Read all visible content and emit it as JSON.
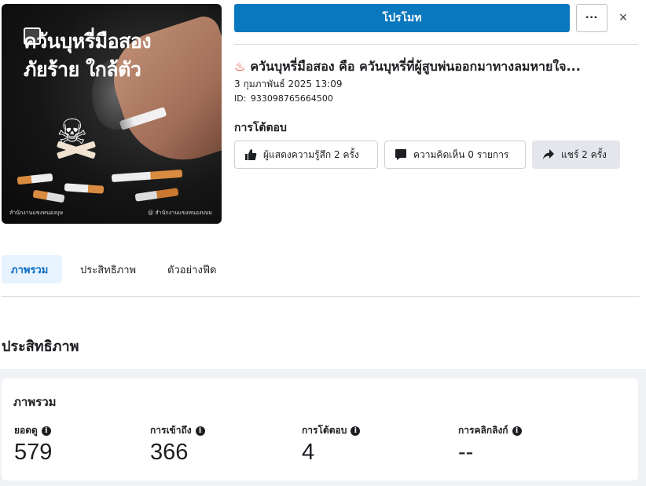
{
  "thumbnail": {
    "headline_line1": "ควันบุหรี่มือสอง",
    "headline_line2": "ภัยร้าย ใกล้ตัว",
    "footer_left": "สำนักงานแขงหนองบุษ",
    "footer_right": "@ สำนักงานแขงหนองบบม"
  },
  "toolbar": {
    "promote_label": "โปรโมท",
    "more_label": "···",
    "close_label": "×"
  },
  "post": {
    "title": "ควันบุหรี่มือสอง คือ ควันบุหรี่ที่ผู้สูบพ่นออกมาทางลมหายใจ...",
    "date": "3 กุมภาพันธ์ 2025 13:09",
    "id_label": "ID:",
    "id_value": "933098765664500"
  },
  "engagement": {
    "heading": "การโต้ตอบ",
    "reactions_label": "ผู้แสดงความรู้สึก 2 ครั้ง",
    "comments_label": "ความคิดเห็น 0 รายการ",
    "shares_label": "แชร์ 2 ครั้ง"
  },
  "tabs": [
    {
      "label": "ภาพรวม",
      "active": true
    },
    {
      "label": "ประสิทธิภาพ",
      "active": false
    },
    {
      "label": "ตัวอย่างฟีด",
      "active": false
    }
  ],
  "performance": {
    "heading": "ประสิทธิภาพ",
    "card_title": "ภาพรวม",
    "metrics": [
      {
        "label": "ยอดดู",
        "value": "579"
      },
      {
        "label": "การเข้าถึง",
        "value": "366"
      },
      {
        "label": "การโต้ตอบ",
        "value": "4"
      },
      {
        "label": "การคลิกลิงก์",
        "value": "--"
      }
    ]
  },
  "colors": {
    "primary": "#0a78be",
    "active_tab_bg": "#e7f3ff",
    "active_tab_text": "#0a6cc1",
    "fire_icon": "#e03b1b",
    "card_bg": "#f0f2f5"
  },
  "icons": [
    "fire-icon",
    "thumbs-up-icon",
    "comment-icon",
    "share-icon",
    "info-icon",
    "close-icon",
    "more-icon"
  ]
}
